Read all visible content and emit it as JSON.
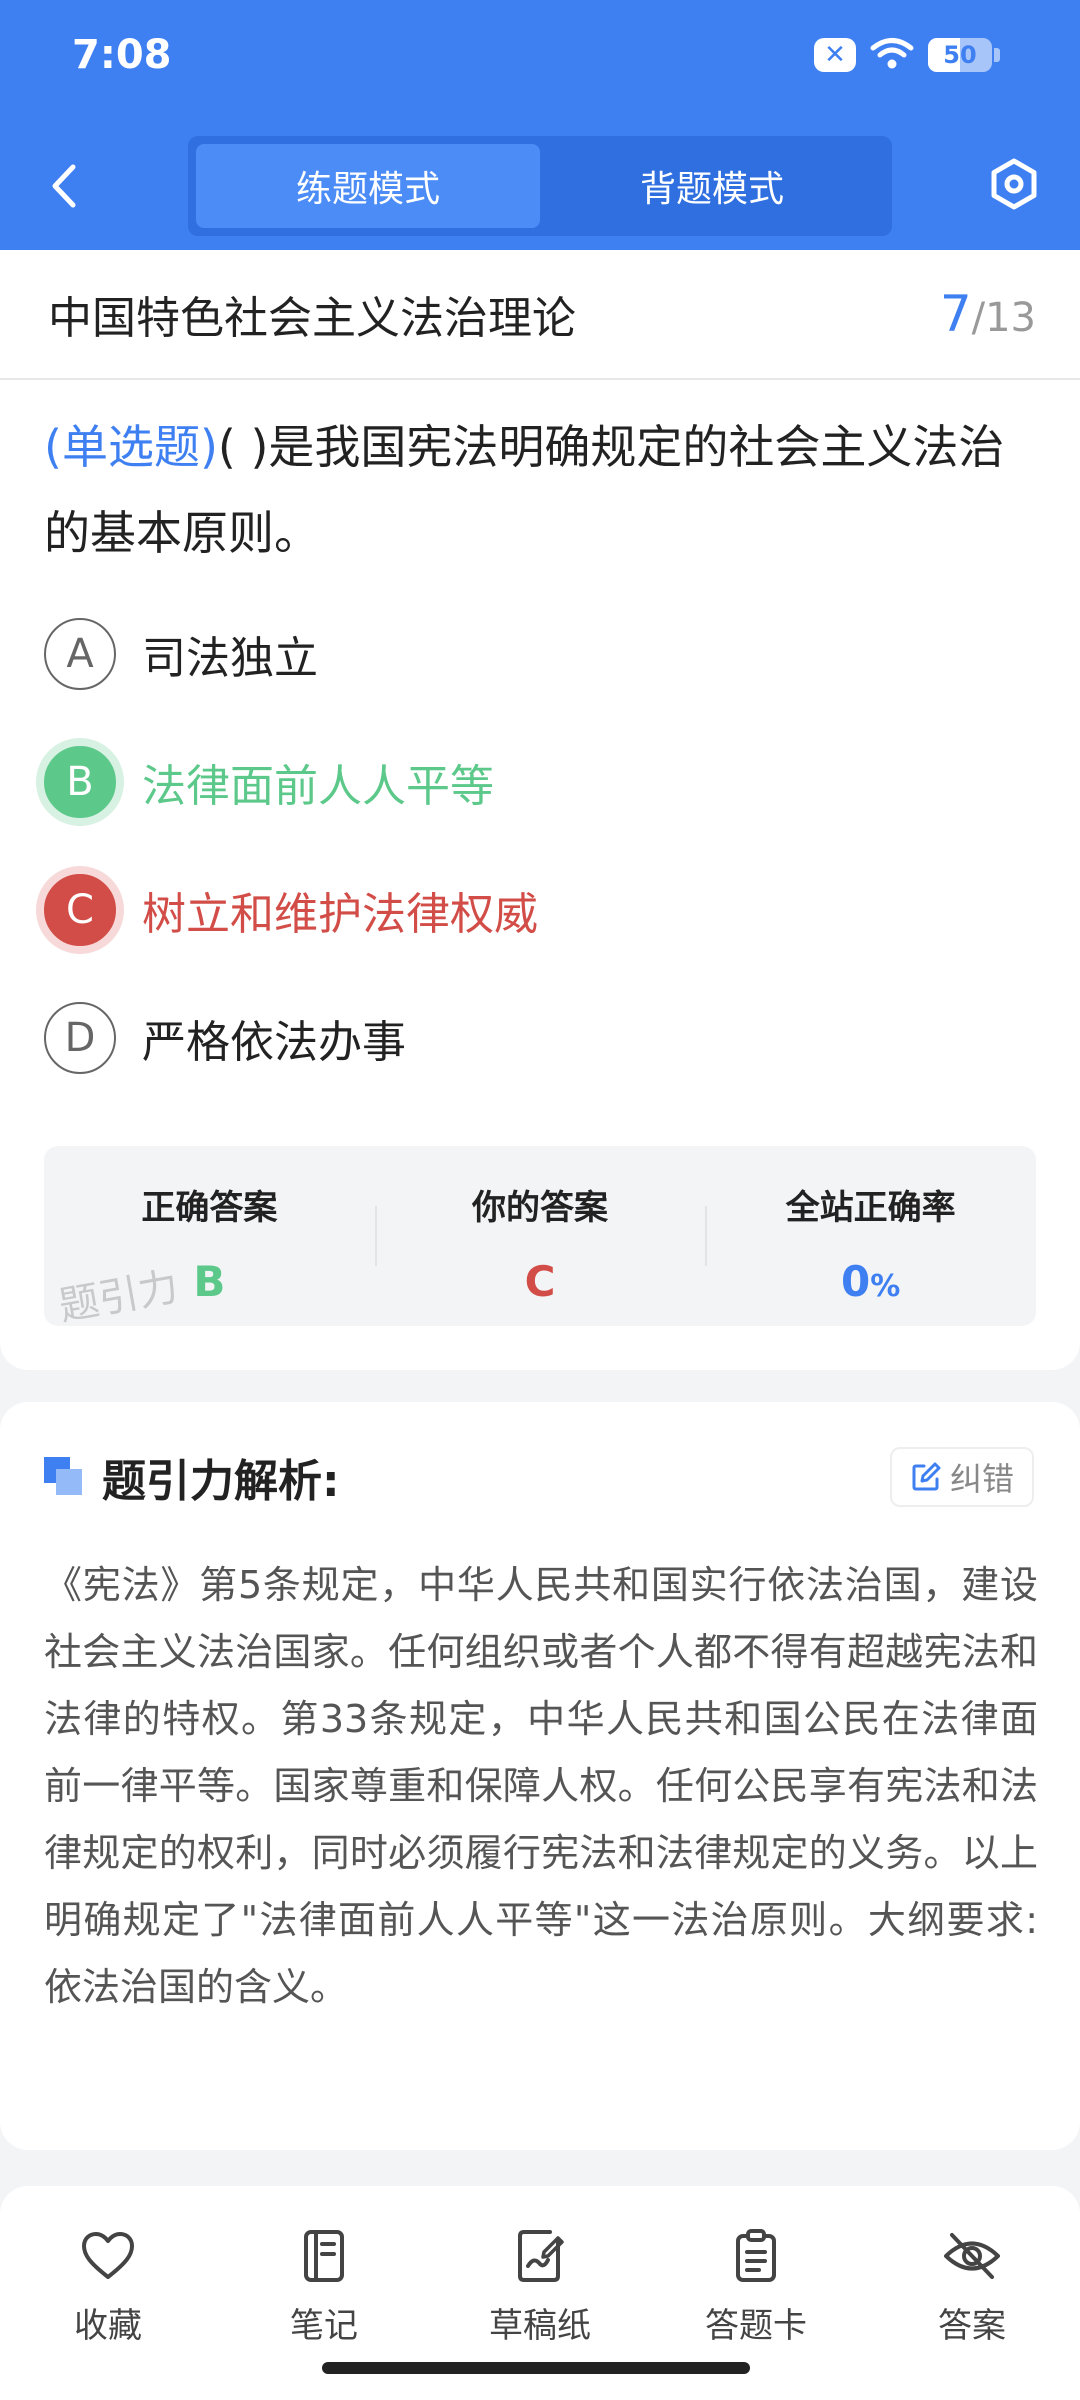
{
  "status": {
    "time": "7:08",
    "battery": "50",
    "battery_level": 0.5
  },
  "header": {
    "modes": [
      {
        "label": "练题模式",
        "active": true
      },
      {
        "label": "背题模式",
        "active": false
      }
    ]
  },
  "question": {
    "topic": "中国特色社会主义法治理论",
    "current": "7",
    "total": "/13",
    "type": "(单选题)",
    "text": "(        )是我国宪法明确规定的社会主义法治的基本原则。",
    "options": [
      {
        "letter": "A",
        "text": "司法独立",
        "state": "normal"
      },
      {
        "letter": "B",
        "text": "法律面前人人平等",
        "state": "correct"
      },
      {
        "letter": "C",
        "text": "树立和维护法律权威",
        "state": "wrong"
      },
      {
        "letter": "D",
        "text": "严格依法办事",
        "state": "normal"
      }
    ]
  },
  "stats": {
    "correct_label": "正确答案",
    "correct_value": "B",
    "yours_label": "你的答案",
    "yours_value": "C",
    "rate_label": "全站正确率",
    "rate_value": "0",
    "rate_unit": "%",
    "watermark": "题引力"
  },
  "analysis": {
    "title": "题引力解析:",
    "report_label": "纠错",
    "text": "《宪法》第5条规定，中华人民共和国实行依法治国，建设社会主义法治国家。任何组织或者个人都不得有超越宪法和法律的特权。第33条规定，中华人民共和国公民在法律面前一律平等。国家尊重和保障人权。任何公民享有宪法和法律规定的权利，同时必须履行宪法和法律规定的义务。以上明确规定了\"法律面前人人平等\"这一法治原则。大纲要求:依法治国的含义。"
  },
  "bottom_tabs": [
    {
      "label": "收藏",
      "icon": "heart-icon"
    },
    {
      "label": "笔记",
      "icon": "notebook-icon"
    },
    {
      "label": "草稿纸",
      "icon": "draft-paper-icon"
    },
    {
      "label": "答题卡",
      "icon": "answer-sheet-icon"
    },
    {
      "label": "答案",
      "icon": "eye-off-icon"
    }
  ],
  "colors": {
    "primary": "#3e7ff2",
    "correct": "#5cc88a",
    "wrong": "#d24d47"
  }
}
